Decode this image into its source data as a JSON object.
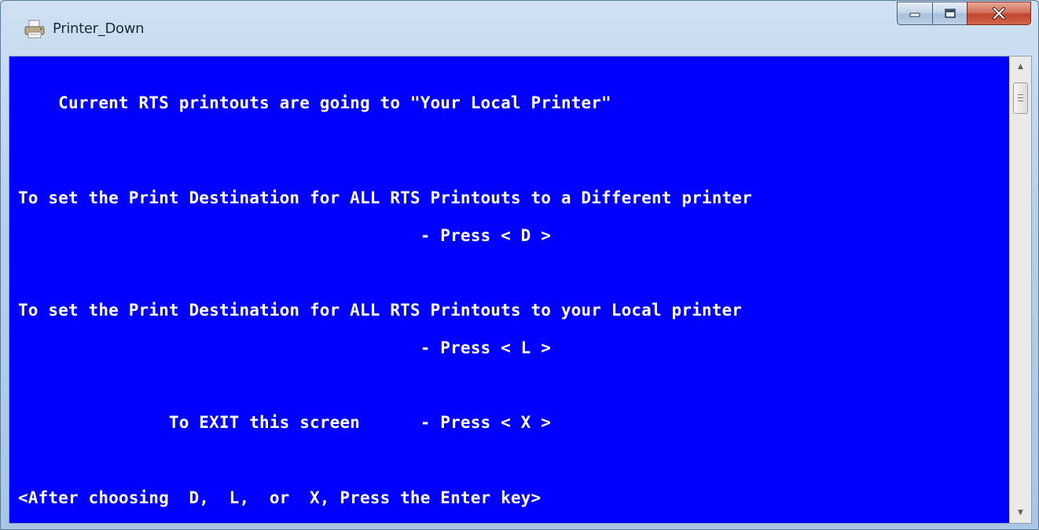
{
  "window": {
    "title": "Printer_Down",
    "icon": "printer-icon",
    "controls": [
      "minimize-icon",
      "maximize-icon",
      "close-icon"
    ]
  },
  "console": {
    "background": "#0000ff",
    "foreground": "#ffffff",
    "lines": [
      "    Current RTS printouts are going to \"Your Local Printer\"",
      "To set the Print Destination for ALL RTS Printouts to a Different printer",
      "                                        - Press < D >",
      "To set the Print Destination for ALL RTS Printouts to your Local printer",
      "                                        - Press < L >",
      "               To EXIT this screen      - Press < X >",
      "<After choosing  D,  L,  or  X, Press the Enter key>"
    ]
  },
  "scrollbar": {
    "up_arrow": "▲",
    "down_arrow": "▼"
  }
}
